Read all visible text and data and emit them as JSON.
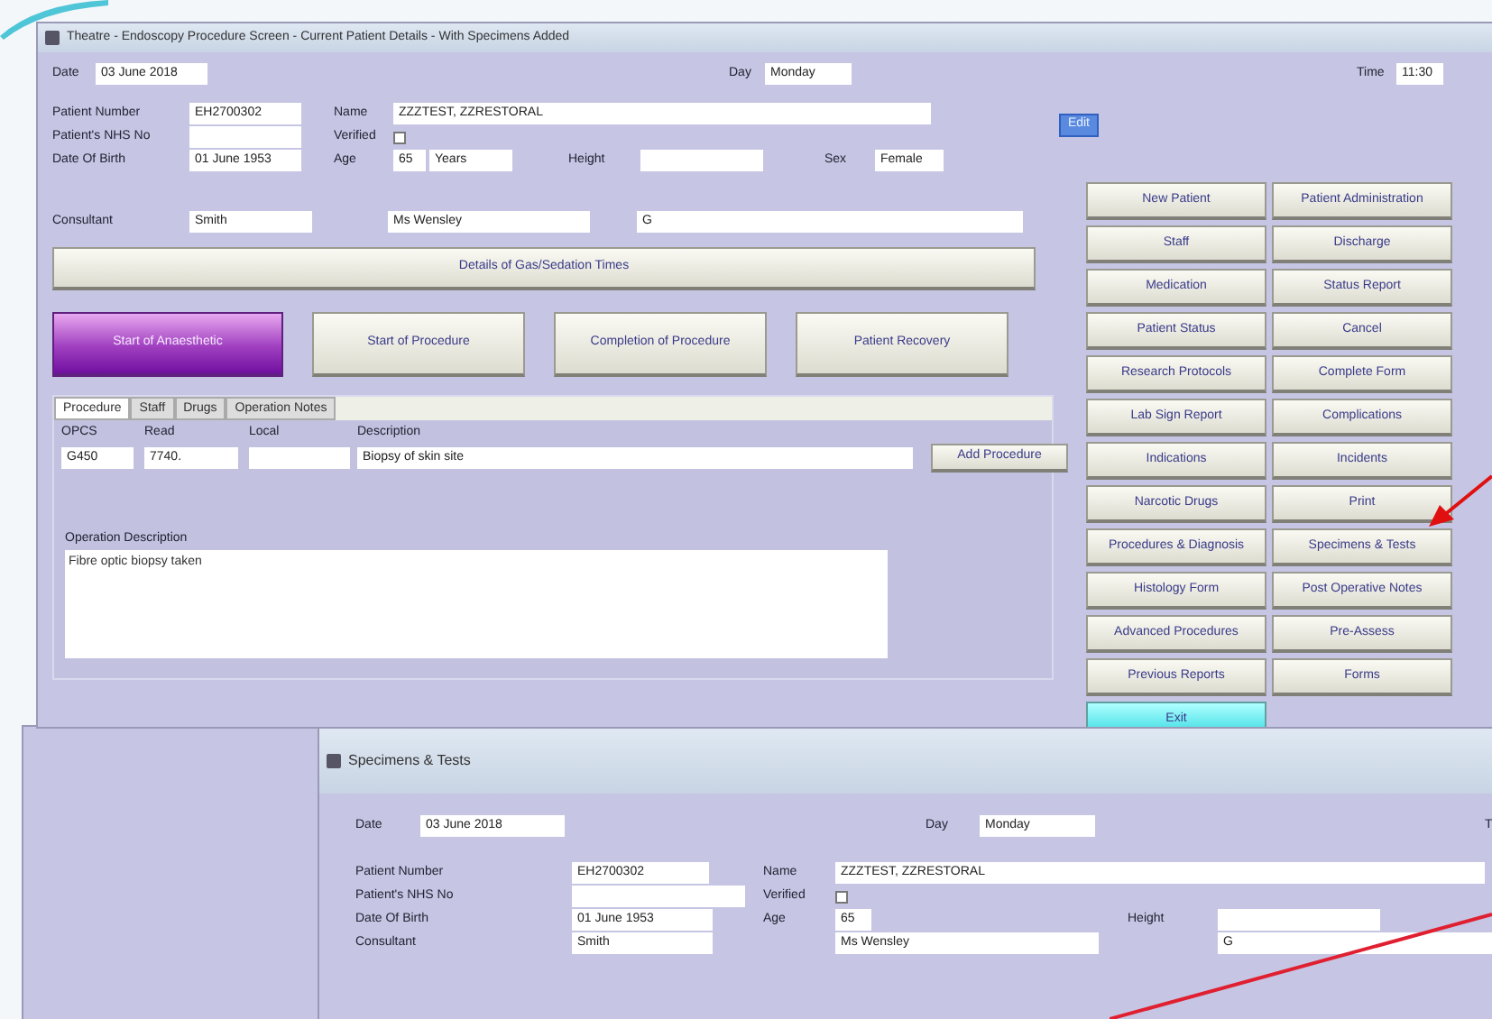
{
  "main_window": {
    "title": "Theatre - Endoscopy Procedure Screen - Current Patient Details - With Specimens Added",
    "header": {
      "date_label": "Date",
      "date": "03 June 2018",
      "day_label": "Day",
      "day": "Monday",
      "time_label": "Time",
      "time": "11:30"
    },
    "patient": {
      "number_label": "Patient Number",
      "number": "EH2700302",
      "nhs_label": "Patient's NHS No",
      "dob_label": "Date Of Birth",
      "dob": "01 June 1953",
      "name_label": "Name",
      "name": "ZZZTEST, ZZRESTORAL",
      "verified_label": "Verified",
      "verified": false,
      "age_label": "Age",
      "age": "65",
      "age_unit": "Years",
      "height_label": "Height",
      "sex_label": "Sex",
      "sex": "Female",
      "edit_button": "Edit"
    },
    "consultant": {
      "label": "Consultant",
      "code": "Smith",
      "name": "Ms Wensley",
      "field_3": "G"
    },
    "details_button": "Details of Gas/Sedation Times",
    "stage_buttons": [
      {
        "label": "Start of Anaesthetic",
        "selected": true
      },
      {
        "label": "Start of Procedure",
        "selected": false
      },
      {
        "label": "Completion of Procedure",
        "selected": false
      },
      {
        "label": "Patient Recovery",
        "selected": false
      }
    ],
    "tabs": [
      {
        "label": "Procedure",
        "selected": true
      },
      {
        "label": "Staff",
        "selected": false
      },
      {
        "label": "Drugs",
        "selected": false
      },
      {
        "label": "Operation Notes",
        "selected": false
      }
    ],
    "procedure": {
      "columns": [
        "OPCS",
        "Read",
        "Local",
        "Description"
      ],
      "opcs": "G450",
      "read": "7740.",
      "description": "Biopsy of skin site",
      "add_button": "Add Procedure",
      "description_label": "Operation Description",
      "description_text": "Fibre optic biopsy taken"
    },
    "menu_buttons": [
      {
        "label": "New Patient",
        "kind": "normal"
      },
      {
        "label": "Patient Administration",
        "kind": "normal"
      },
      {
        "label": "Staff",
        "kind": "normal"
      },
      {
        "label": "Discharge",
        "kind": "normal"
      },
      {
        "label": "Medication",
        "kind": "normal"
      },
      {
        "label": "Status Report",
        "kind": "normal"
      },
      {
        "label": "Patient Status",
        "kind": "normal"
      },
      {
        "label": "Cancel",
        "kind": "normal"
      },
      {
        "label": "Research Protocols",
        "kind": "normal"
      },
      {
        "label": "Complete Form",
        "kind": "normal"
      },
      {
        "label": "Lab Sign Report",
        "kind": "normal"
      },
      {
        "label": "Complications",
        "kind": "normal"
      },
      {
        "label": "Indications",
        "kind": "normal"
      },
      {
        "label": "Incidents",
        "kind": "normal"
      },
      {
        "label": "Narcotic Drugs",
        "kind": "normal"
      },
      {
        "label": "Print",
        "kind": "normal"
      },
      {
        "label": "Procedures & Diagnosis",
        "kind": "normal"
      },
      {
        "label": "Specimens & Tests",
        "kind": "normal"
      },
      {
        "label": "Histology Form",
        "kind": "normal"
      },
      {
        "label": "Post Operative Notes",
        "kind": "normal"
      },
      {
        "label": "Advanced Procedures",
        "kind": "normal"
      },
      {
        "label": "Pre-Assess",
        "kind": "normal"
      },
      {
        "label": "Previous Reports",
        "kind": "normal"
      },
      {
        "label": "Forms",
        "kind": "normal"
      },
      {
        "label": "Exit",
        "kind": "exit"
      }
    ]
  },
  "specimens_window": {
    "title": "Specimens & Tests",
    "date_label": "Date",
    "date": "03 June 2018",
    "day_label": "Day",
    "day": "Monday",
    "time_label_partial": "T",
    "number_label": "Patient Number",
    "number": "EH2700302",
    "nhs_label": "Patient's NHS No",
    "dob_label": "Date Of Birth",
    "dob": "01 June 1953",
    "consultant_label": "Consultant",
    "consultant": "Smith",
    "name_label": "Name",
    "name": "ZZZTEST, ZZRESTORAL",
    "verified_label": "Verified",
    "verified": false,
    "age_label": "Age",
    "age": "65",
    "consultant_name": "Ms Wensley",
    "height_label": "Height",
    "field_3": "G"
  }
}
